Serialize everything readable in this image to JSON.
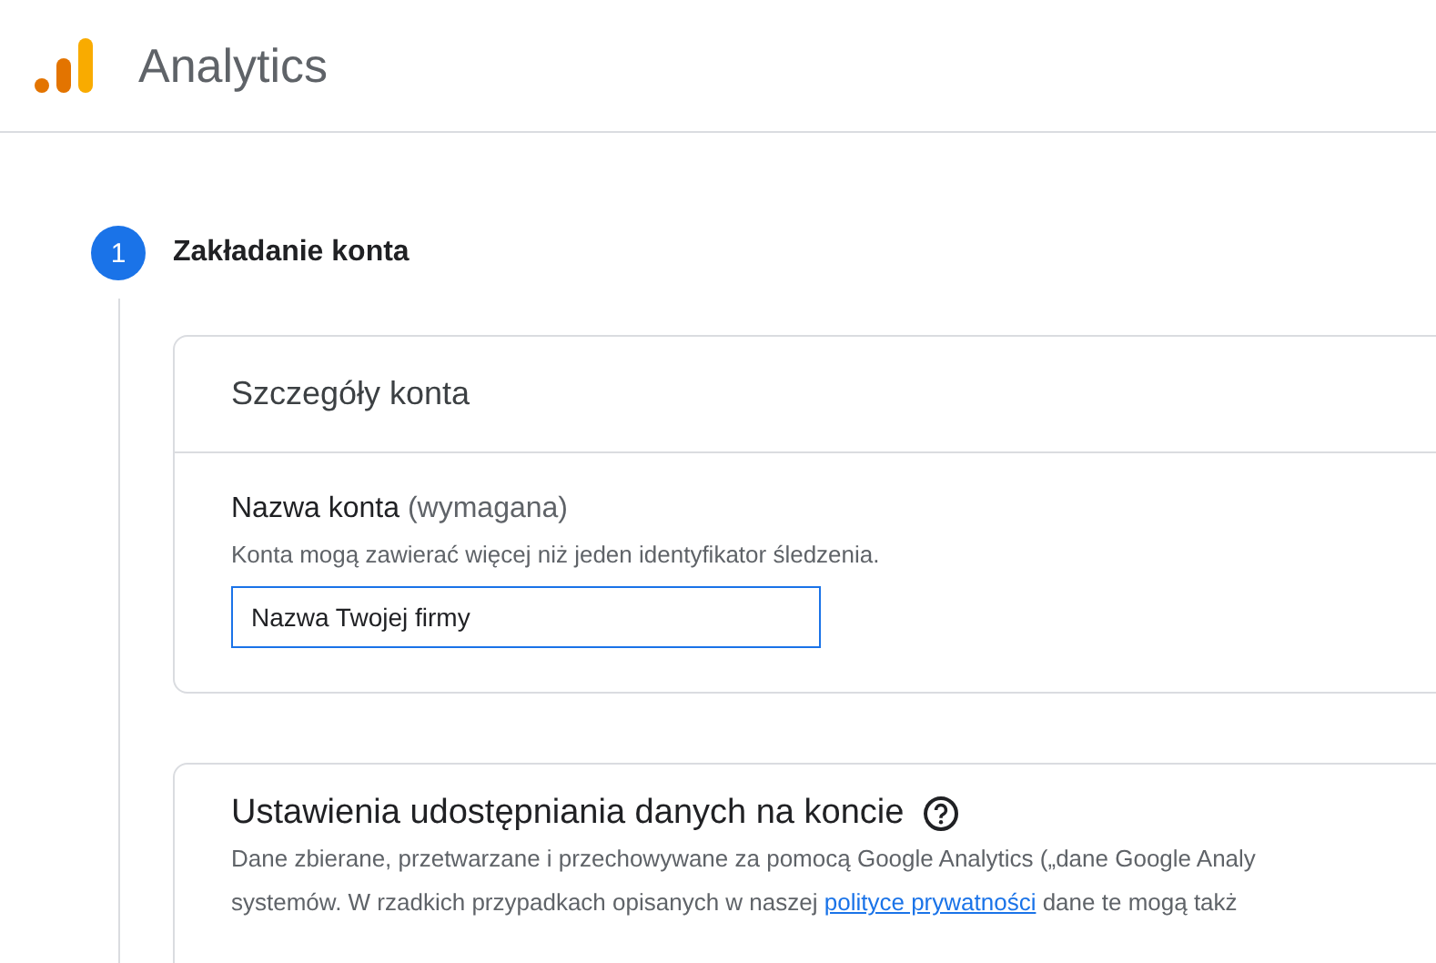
{
  "header": {
    "title": "Analytics"
  },
  "step": {
    "number": "1",
    "title": "Zakładanie konta",
    "selected": true
  },
  "account_details": {
    "title": "Szczegóły konta",
    "field_label": "Nazwa konta",
    "field_required": "(wymagana)",
    "field_hint": "Konta mogą zawierać więcej niż jeden identyfikator śledzenia.",
    "field_value": "Nazwa Twojej firmy"
  },
  "data_sharing": {
    "title": "Ustawienia udostępniania danych na koncie",
    "line_1": "Dane zbierane, przetwarzane i przechowywane za pomocą Google Analytics („dane Google Analy",
    "line_2_before": "systemów. W rzadkich przypadkach opisanych w naszej",
    "link": "polityce prywatności",
    "line_2_after": "dane te mogą takż"
  }
}
